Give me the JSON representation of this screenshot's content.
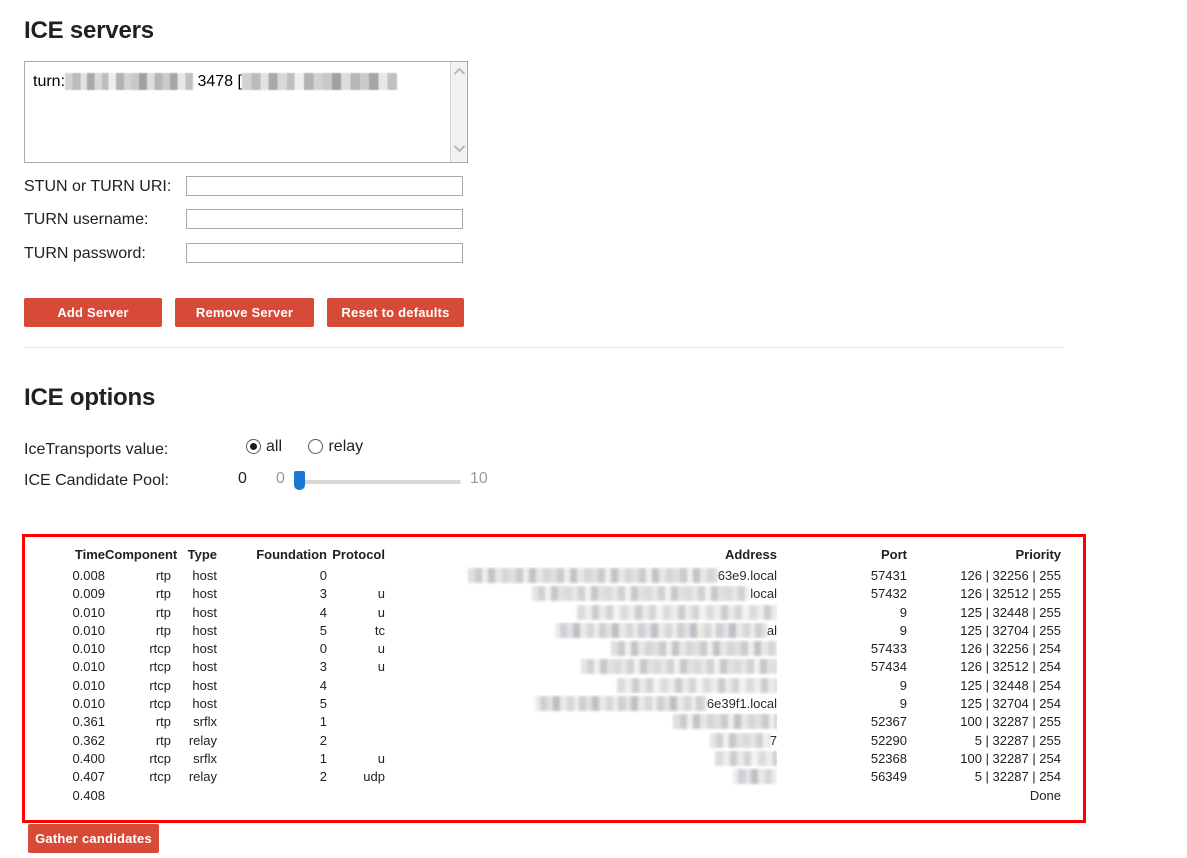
{
  "sections": {
    "ice_servers_title": "ICE servers",
    "ice_options_title": "ICE options"
  },
  "servers": {
    "entry_prefix": "turn:",
    "entry_port": "3478",
    "entry_bracket": "[",
    "scroll_up_icon": "chevron-up-icon",
    "scroll_down_icon": "chevron-down-icon"
  },
  "form": {
    "uri_label": "STUN or TURN URI:",
    "uri_value": "",
    "uri_placeholder": "",
    "username_label": "TURN username:",
    "username_value": "",
    "username_placeholder": "",
    "password_label": "TURN password:",
    "password_value": "",
    "password_placeholder": ""
  },
  "buttons": {
    "add_server": "Add Server",
    "remove_server": "Remove Server",
    "reset_defaults": "Reset to defaults",
    "gather_candidates": "Gather candidates",
    "color": "#d84a38"
  },
  "options": {
    "transports_label": "IceTransports value:",
    "transports_options": [
      "all",
      "relay"
    ],
    "transports_selected": "all",
    "pool_label": "ICE Candidate Pool:",
    "pool_value": "0",
    "pool_min": "0",
    "pool_max": "10",
    "slider_color": "#1878d4"
  },
  "results": {
    "border_color": "#ff0000",
    "headers": [
      "Time",
      "Component",
      "Type",
      "Foundation",
      "Protocol",
      "Address",
      "Port",
      "Priority"
    ],
    "rows": [
      {
        "time": "0.008",
        "component": "rtp",
        "type": "host",
        "foundation": "0",
        "protocol": "",
        "address_tail": "63e9.local",
        "port": "57431",
        "priority": "126 | 32256 | 255"
      },
      {
        "time": "0.009",
        "component": "rtp",
        "type": "host",
        "foundation": "3",
        "protocol": "u",
        "address_tail": "local",
        "port": "57432",
        "priority": "126 | 32512 | 255"
      },
      {
        "time": "0.010",
        "component": "rtp",
        "type": "host",
        "foundation": "4",
        "protocol": "u",
        "address_tail": "",
        "port": "9",
        "priority": "125 | 32448 | 255"
      },
      {
        "time": "0.010",
        "component": "rtp",
        "type": "host",
        "foundation": "5",
        "protocol": "tc",
        "address_tail": "al",
        "port": "9",
        "priority": "125 | 32704 | 255"
      },
      {
        "time": "0.010",
        "component": "rtcp",
        "type": "host",
        "foundation": "0",
        "protocol": "u",
        "address_tail": "",
        "port": "57433",
        "priority": "126 | 32256 | 254"
      },
      {
        "time": "0.010",
        "component": "rtcp",
        "type": "host",
        "foundation": "3",
        "protocol": "u",
        "address_tail": "",
        "port": "57434",
        "priority": "126 | 32512 | 254"
      },
      {
        "time": "0.010",
        "component": "rtcp",
        "type": "host",
        "foundation": "4",
        "protocol": "",
        "address_tail": "",
        "port": "9",
        "priority": "125 | 32448 | 254"
      },
      {
        "time": "0.010",
        "component": "rtcp",
        "type": "host",
        "foundation": "5",
        "protocol": "",
        "address_tail": "6e39f1.local",
        "port": "9",
        "priority": "125 | 32704 | 254"
      },
      {
        "time": "0.361",
        "component": "rtp",
        "type": "srflx",
        "foundation": "1",
        "protocol": "",
        "address_tail": "",
        "port": "52367",
        "priority": "100 | 32287 | 255"
      },
      {
        "time": "0.362",
        "component": "rtp",
        "type": "relay",
        "foundation": "2",
        "protocol": "",
        "address_tail": "7",
        "port": "52290",
        "priority": "5 | 32287 | 255"
      },
      {
        "time": "0.400",
        "component": "rtcp",
        "type": "srflx",
        "foundation": "1",
        "protocol": "u",
        "address_tail": "",
        "port": "52368",
        "priority": "100 | 32287 | 254"
      },
      {
        "time": "0.407",
        "component": "rtcp",
        "type": "relay",
        "foundation": "2",
        "protocol": "udp",
        "address_tail": "",
        "port": "56349",
        "priority": "5 | 32287 | 254"
      },
      {
        "time": "0.408",
        "component": "",
        "type": "",
        "foundation": "",
        "protocol": "",
        "address_tail": "",
        "port": "",
        "priority": "Done"
      }
    ]
  }
}
